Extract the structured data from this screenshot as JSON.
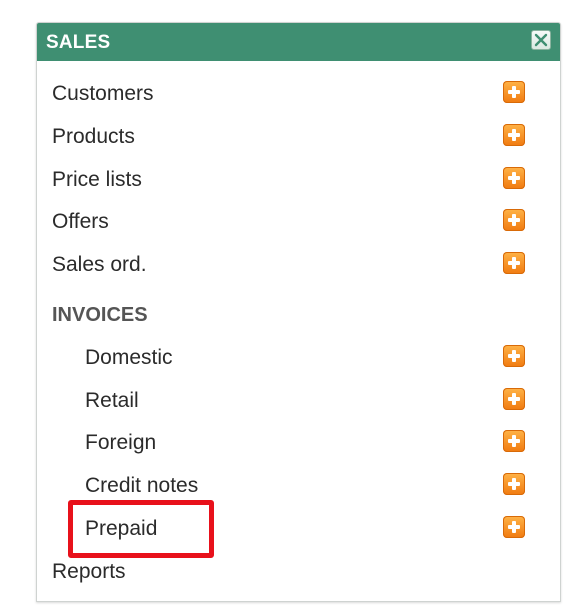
{
  "panel": {
    "title": "SALES",
    "header_color": "#3f8f72",
    "close_icon": "close-icon"
  },
  "items": [
    {
      "label": "Customers",
      "action_icon": "plus-icon"
    },
    {
      "label": "Products",
      "action_icon": "plus-icon"
    },
    {
      "label": "Price lists",
      "action_icon": "plus-icon"
    },
    {
      "label": "Offers",
      "action_icon": "plus-icon"
    },
    {
      "label": "Sales ord.",
      "action_icon": "plus-icon"
    }
  ],
  "invoices": {
    "heading": "INVOICES",
    "items": [
      {
        "label": "Domestic",
        "action_icon": "plus-icon"
      },
      {
        "label": "Retail",
        "action_icon": "plus-icon"
      },
      {
        "label": "Foreign",
        "action_icon": "plus-icon"
      },
      {
        "label": "Credit notes",
        "action_icon": "plus-icon"
      },
      {
        "label": "Prepaid",
        "action_icon": "plus-icon",
        "highlighted": true
      }
    ]
  },
  "reports": {
    "label": "Reports"
  },
  "highlight_color": "#e8111b",
  "add_icon_color": "#f58a1f"
}
